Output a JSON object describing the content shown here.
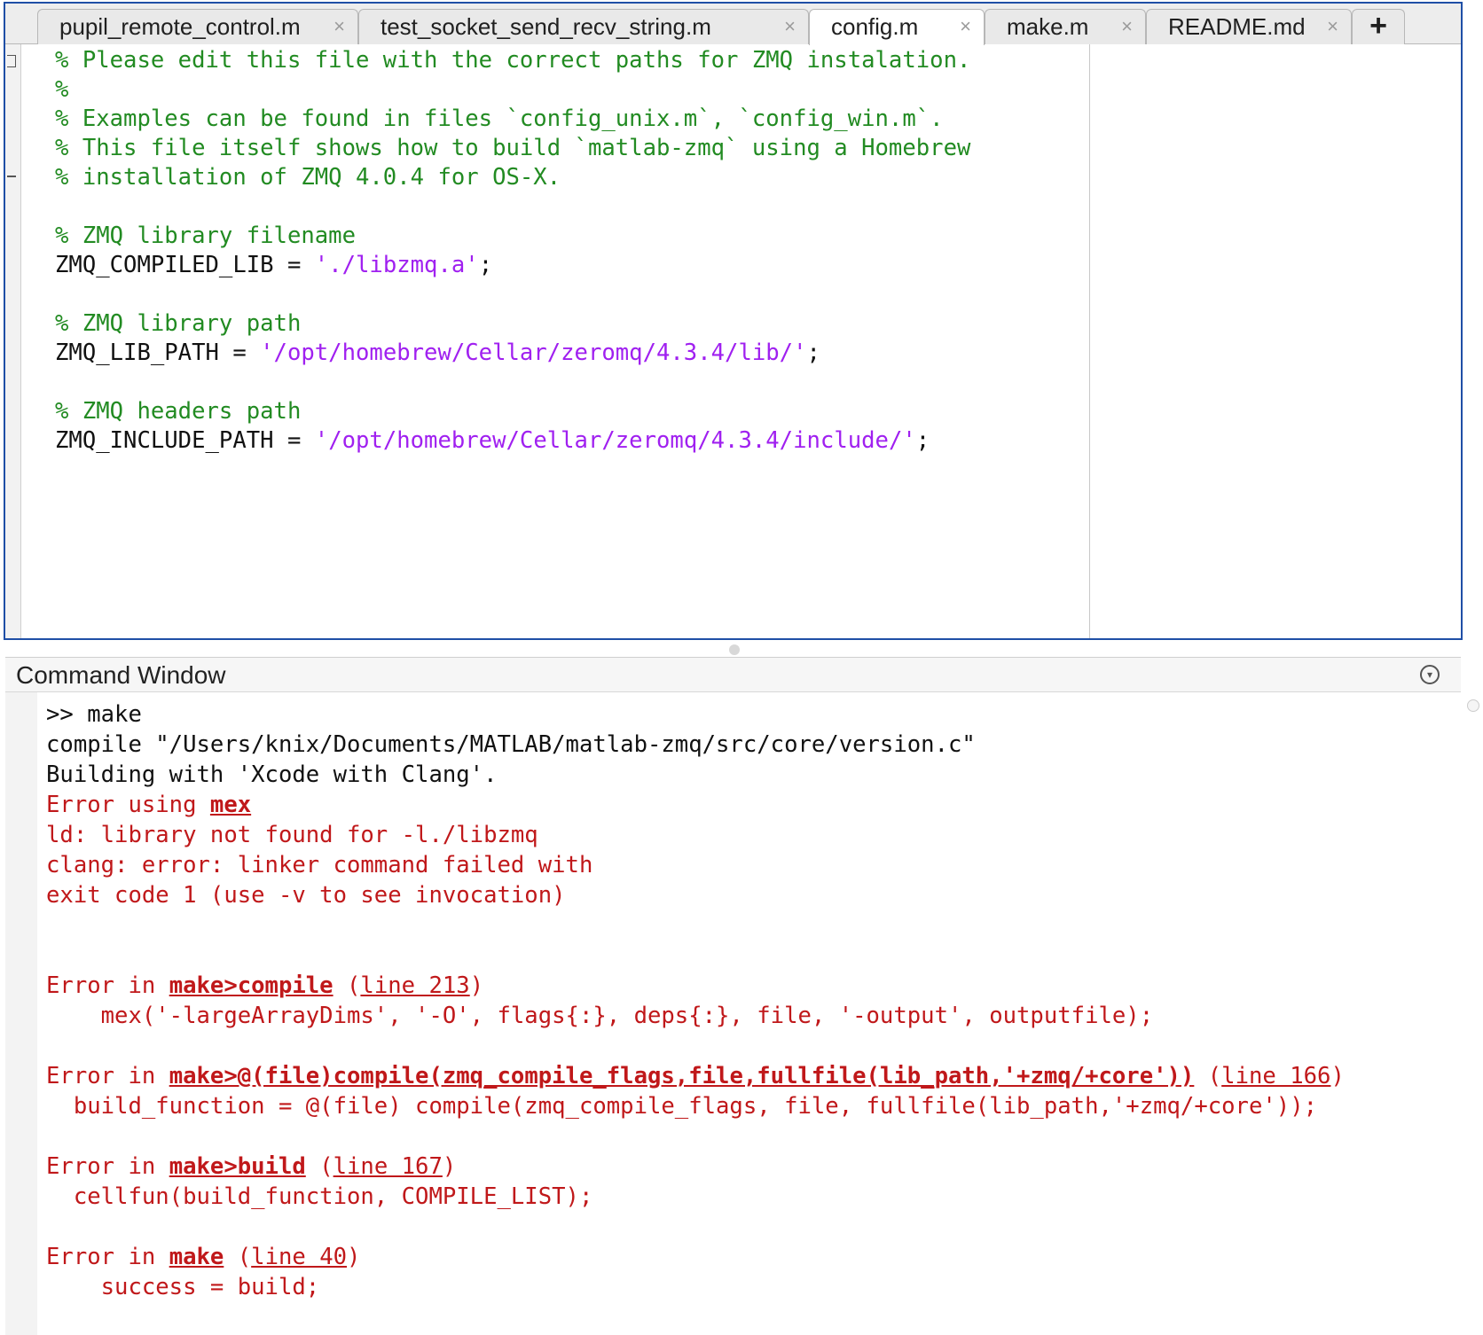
{
  "tabs": [
    {
      "label": "pupil_remote_control.m",
      "active": false
    },
    {
      "label": "test_socket_send_recv_string.m",
      "active": false
    },
    {
      "label": "config.m",
      "active": true
    },
    {
      "label": "make.m",
      "active": false
    },
    {
      "label": "README.md",
      "active": false
    }
  ],
  "tab_close_glyph": "×",
  "tab_add_glyph": "+",
  "editor": {
    "lines": [
      [
        {
          "t": "% Please edit this file with the correct paths for ZMQ instalation.",
          "c": "cm"
        }
      ],
      [
        {
          "t": "%",
          "c": "cm"
        }
      ],
      [
        {
          "t": "% Examples can be found in files `config_unix.m`, `config_win.m`.",
          "c": "cm"
        }
      ],
      [
        {
          "t": "% This file itself shows how to build `matlab-zmq` using a Homebrew",
          "c": "cm"
        }
      ],
      [
        {
          "t": "% installation of ZMQ 4.0.4 for OS-X.",
          "c": "cm"
        }
      ],
      [],
      [
        {
          "t": "% ZMQ library filename",
          "c": "cm"
        }
      ],
      [
        {
          "t": "ZMQ_COMPILED_LIB = ",
          "c": ""
        },
        {
          "t": "'./libzmq.a'",
          "c": "str"
        },
        {
          "t": ";",
          "c": ""
        }
      ],
      [],
      [
        {
          "t": "% ZMQ library path",
          "c": "cm"
        }
      ],
      [
        {
          "t": "ZMQ_LIB_PATH = ",
          "c": ""
        },
        {
          "t": "'/opt/homebrew/Cellar/zeromq/4.3.4/lib/'",
          "c": "str"
        },
        {
          "t": ";",
          "c": ""
        }
      ],
      [],
      [
        {
          "t": "% ZMQ headers path",
          "c": "cm"
        }
      ],
      [
        {
          "t": "ZMQ_INCLUDE_PATH = ",
          "c": ""
        },
        {
          "t": "'/opt/homebrew/Cellar/zeromq/4.3.4/include/'",
          "c": "str"
        },
        {
          "t": ";",
          "c": ""
        }
      ]
    ]
  },
  "command_window": {
    "title": "Command Window",
    "lines": [
      [
        {
          "t": ">> make",
          "c": ""
        }
      ],
      [
        {
          "t": "compile \"/Users/knix/Documents/MATLAB/matlab-zmq/src/core/version.c\"",
          "c": ""
        }
      ],
      [
        {
          "t": "Building with 'Xcode with Clang'.",
          "c": ""
        }
      ],
      [
        {
          "t": "Error using ",
          "c": "err"
        },
        {
          "t": "mex",
          "c": "lnk"
        }
      ],
      [
        {
          "t": "ld: library not found for -l./libzmq",
          "c": "err"
        }
      ],
      [
        {
          "t": "clang: error: linker command failed with",
          "c": "err"
        }
      ],
      [
        {
          "t": "exit code 1 (use -v to see invocation)",
          "c": "err"
        }
      ],
      [],
      [],
      [
        {
          "t": "Error in ",
          "c": "err"
        },
        {
          "t": "make>compile",
          "c": "lnk"
        },
        {
          "t": " (",
          "c": "err"
        },
        {
          "t": "line 213",
          "c": "lnk-plain"
        },
        {
          "t": ")",
          "c": "err"
        }
      ],
      [
        {
          "t": "    mex('-largeArrayDims', '-O', flags{:}, deps{:}, file, '-output', outputfile);",
          "c": "err"
        }
      ],
      [],
      [
        {
          "t": "Error in ",
          "c": "err"
        },
        {
          "t": "make>@(file)compile(zmq_compile_flags,file,fullfile(lib_path,'+zmq/+core'))",
          "c": "lnk"
        },
        {
          "t": " (",
          "c": "err"
        },
        {
          "t": "line 166",
          "c": "lnk-plain"
        },
        {
          "t": ")",
          "c": "err"
        }
      ],
      [
        {
          "t": "  build_function = @(file) compile(zmq_compile_flags, file, fullfile(lib_path,'+zmq/+core'));",
          "c": "err"
        }
      ],
      [],
      [
        {
          "t": "Error in ",
          "c": "err"
        },
        {
          "t": "make>build",
          "c": "lnk"
        },
        {
          "t": " (",
          "c": "err"
        },
        {
          "t": "line 167",
          "c": "lnk-plain"
        },
        {
          "t": ")",
          "c": "err"
        }
      ],
      [
        {
          "t": "  cellfun(build_function, COMPILE_LIST);",
          "c": "err"
        }
      ],
      [],
      [
        {
          "t": "Error in ",
          "c": "err"
        },
        {
          "t": "make",
          "c": "lnk"
        },
        {
          "t": " (",
          "c": "err"
        },
        {
          "t": "line 40",
          "c": "lnk-plain"
        },
        {
          "t": ")",
          "c": "err"
        }
      ],
      [
        {
          "t": "    success = build;",
          "c": "err"
        }
      ]
    ]
  }
}
